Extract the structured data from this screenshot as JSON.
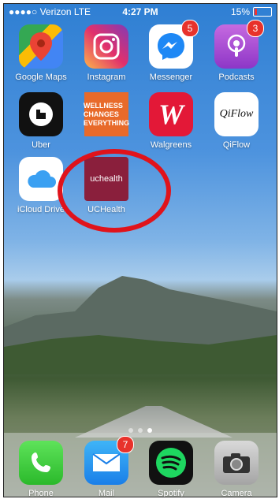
{
  "status_bar": {
    "carrier": "●●●●○ Verizon  LTE",
    "time": "4:27 PM",
    "battery": "15%"
  },
  "apps": [
    {
      "name": "Google Maps",
      "icon": "google-maps-icon",
      "badge": ""
    },
    {
      "name": "Instagram",
      "icon": "instagram-icon",
      "badge": ""
    },
    {
      "name": "Messenger",
      "icon": "messenger-icon",
      "badge": "5"
    },
    {
      "name": "Podcasts",
      "icon": "podcasts-icon",
      "badge": "3"
    },
    {
      "name": "Uber",
      "icon": "uber-icon",
      "badge": ""
    },
    {
      "name": "",
      "icon": "wellness-icon",
      "badge": "",
      "icon_text": "WELLNESS CHANGES EVERYTHING"
    },
    {
      "name": "Walgreens",
      "icon": "walgreens-icon",
      "badge": "",
      "icon_text": "W"
    },
    {
      "name": "QiFlow",
      "icon": "qiflow-icon",
      "badge": "",
      "icon_text": "QiFlow"
    },
    {
      "name": "iCloud Drive",
      "icon": "icloud-drive-icon",
      "badge": ""
    },
    {
      "name": "UCHealth",
      "icon": "uchealth-icon",
      "badge": "",
      "icon_text": "uchealth"
    }
  ],
  "dock": [
    {
      "name": "Phone",
      "icon": "phone-icon",
      "badge": ""
    },
    {
      "name": "Mail",
      "icon": "mail-icon",
      "badge": "7"
    },
    {
      "name": "Spotify",
      "icon": "spotify-icon",
      "badge": ""
    },
    {
      "name": "Camera",
      "icon": "camera-icon",
      "badge": ""
    }
  ],
  "page_dots": {
    "count": 3,
    "active_index": 2
  },
  "highlight_color": "#e0131b"
}
